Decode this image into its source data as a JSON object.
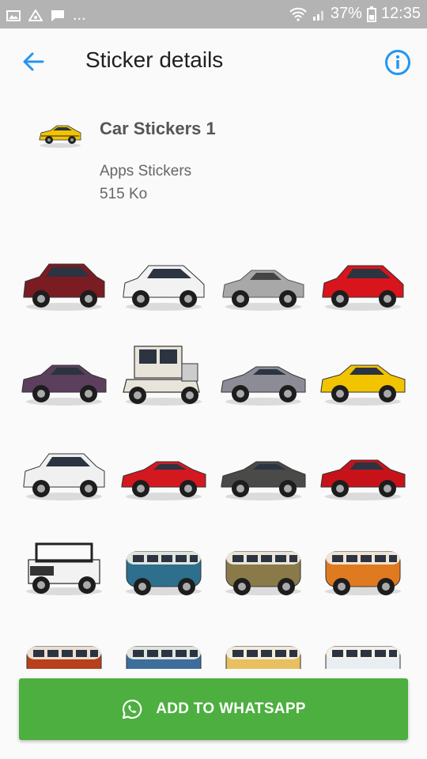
{
  "status": {
    "more": "...",
    "battery": "37%",
    "time": "12:35"
  },
  "appbar": {
    "title": "Sticker details"
  },
  "pack": {
    "name": "Car Stickers 1",
    "publisher": "Apps Stickers",
    "size": "515 Ko"
  },
  "icons": {
    "back": "arrow-back-icon",
    "info": "info-icon",
    "whatsapp": "whatsapp-icon"
  },
  "colors": {
    "accent": "#2196f3",
    "button": "#4caf3f",
    "statusbar": "#b3b3b3"
  },
  "stickers": [
    {
      "name": "sticker-red-suv",
      "color": "#7a1c22",
      "kind": "suv"
    },
    {
      "name": "sticker-white-hatchback",
      "color": "#f2f2f2",
      "kind": "hatch"
    },
    {
      "name": "sticker-silver-classic-car",
      "color": "#a8a8a8",
      "kind": "classic"
    },
    {
      "name": "sticker-red-hatchback",
      "color": "#d8141c",
      "kind": "hatch"
    },
    {
      "name": "sticker-purple-coupe",
      "color": "#5b3f5c",
      "kind": "coupe"
    },
    {
      "name": "sticker-vintage-white-car",
      "color": "#e8e4da",
      "kind": "vintage"
    },
    {
      "name": "sticker-silver-convertible",
      "color": "#8c8c96",
      "kind": "sport"
    },
    {
      "name": "sticker-yellow-muscle-car",
      "color": "#f2c400",
      "kind": "coupe"
    },
    {
      "name": "sticker-white-suv",
      "color": "#f0f0f0",
      "kind": "suv"
    },
    {
      "name": "sticker-red-sports-car",
      "color": "#d41820",
      "kind": "sport"
    },
    {
      "name": "sticker-grey-supercar",
      "color": "#4a4a48",
      "kind": "sport"
    },
    {
      "name": "sticker-red-mustang",
      "color": "#c8121a",
      "kind": "coupe"
    },
    {
      "name": "sticker-white-jeep",
      "color": "#f2f2f2",
      "kind": "jeep"
    },
    {
      "name": "sticker-blue-vw-bus",
      "color": "#2e6f8e",
      "kind": "bus"
    },
    {
      "name": "sticker-painted-vw-bus",
      "color": "#8a7a4a",
      "kind": "bus"
    },
    {
      "name": "sticker-orange-camper-van",
      "color": "#e07a20",
      "kind": "bus"
    },
    {
      "name": "sticker-red-vw-bus",
      "color": "#b8401a",
      "kind": "bus"
    },
    {
      "name": "sticker-blue-white-vw-bus",
      "color": "#3d6e9c",
      "kind": "bus"
    },
    {
      "name": "sticker-yellow-surf-van",
      "color": "#e8c060",
      "kind": "bus"
    },
    {
      "name": "sticker-white-vw-bus",
      "color": "#e8eef2",
      "kind": "bus"
    }
  ],
  "button": {
    "label": "ADD TO WHATSAPP"
  }
}
